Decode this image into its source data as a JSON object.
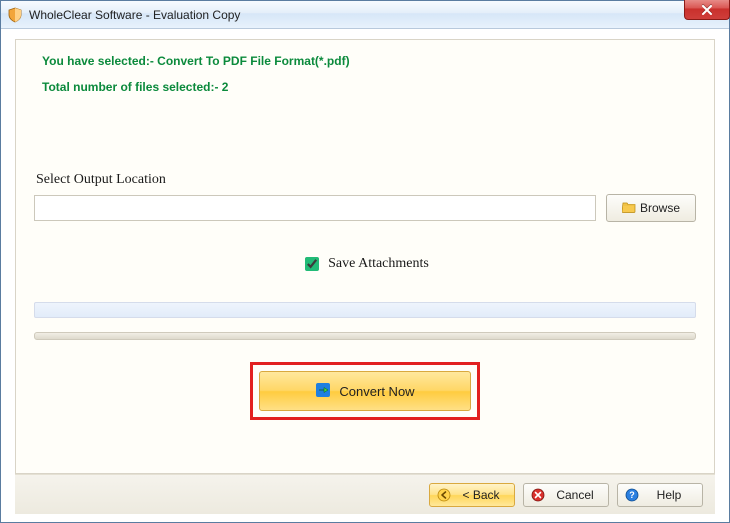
{
  "window": {
    "title": "WholeClear Software - Evaluation Copy"
  },
  "panel": {
    "selection_line": "You have selected:- Convert To PDF File Format(*.pdf)",
    "count_line": "Total number of files selected:- 2",
    "output_label": "Select Output Location",
    "output_value": "",
    "browse_label": "Browse",
    "save_attachments_label": "Save Attachments",
    "save_attachments_checked": true,
    "convert_label": "Convert Now"
  },
  "footer": {
    "back_label": "< Back",
    "cancel_label": "Cancel",
    "help_label": "Help"
  }
}
